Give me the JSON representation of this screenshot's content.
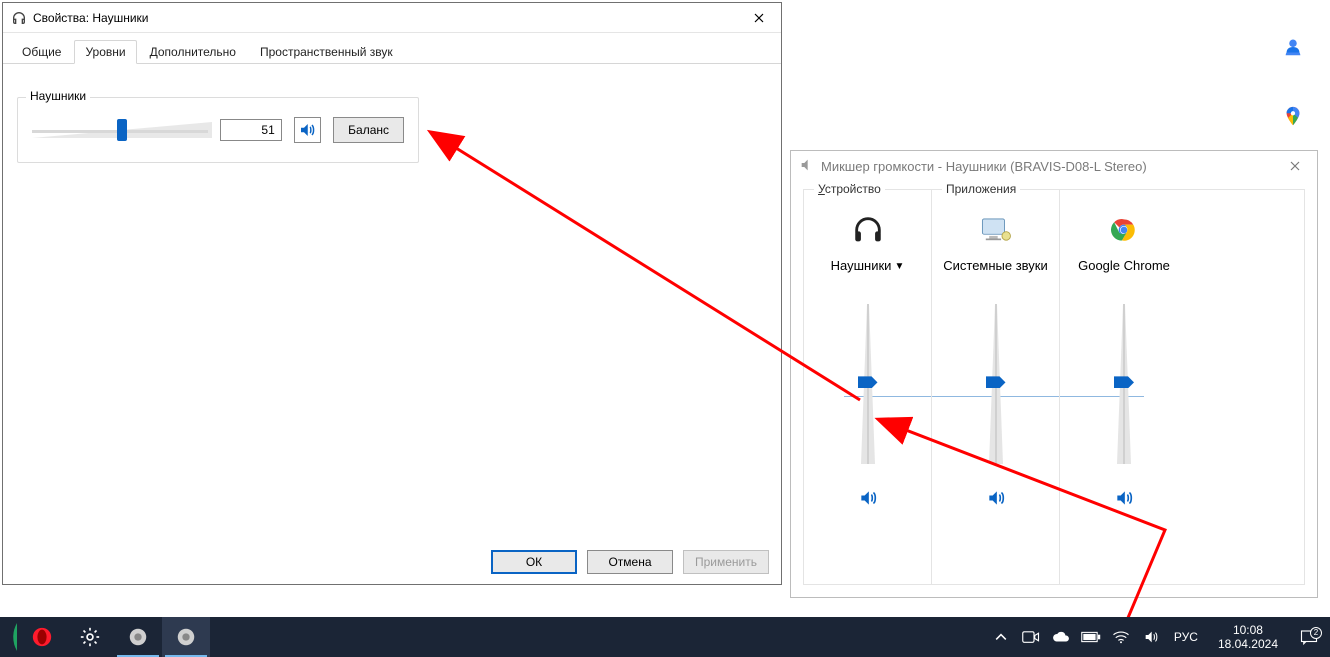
{
  "properties_window": {
    "title": "Свойства: Наушники",
    "tabs": {
      "general": "Общие",
      "levels": "Уровни",
      "advanced": "Дополнительно",
      "spatial": "Пространственный звук"
    },
    "group_label": "Наушники",
    "level_value": "51",
    "balance_button": "Баланс",
    "buttons": {
      "ok": "ОК",
      "cancel": "Отмена",
      "apply": "Применить"
    }
  },
  "mixer_window": {
    "title": "Микшер громкости - Наушники (BRAVIS-D08-L Stereo)",
    "group_device": "Устройство",
    "group_apps": "Приложения",
    "channels": {
      "device": {
        "name": "Наушники",
        "level": 51
      },
      "system": {
        "name": "Системные звуки",
        "level": 51
      },
      "chrome": {
        "name": "Google Chrome",
        "level": 51
      }
    }
  },
  "taskbar": {
    "lang": "РУС",
    "time": "10:08",
    "date": "18.04.2024",
    "notif_count": "2"
  }
}
